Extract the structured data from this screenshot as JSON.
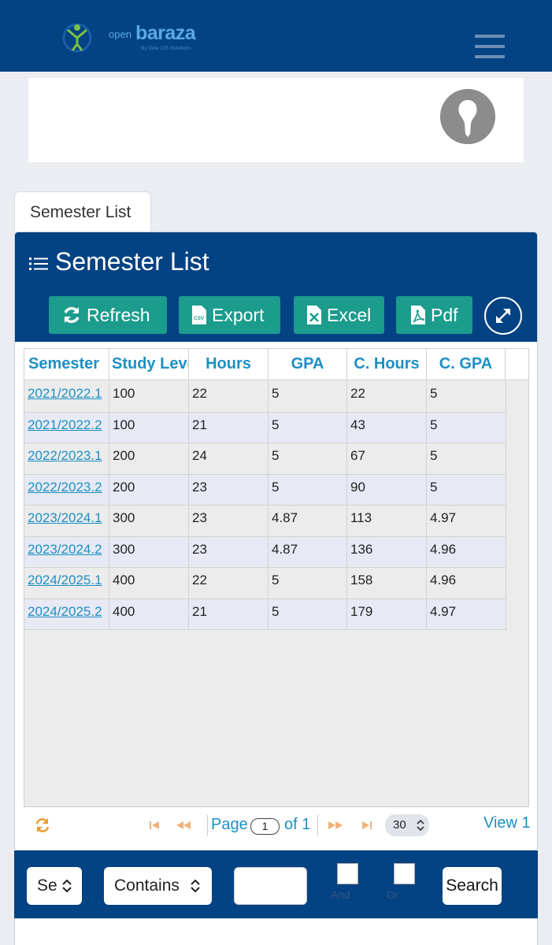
{
  "header": {
    "logo_open": "open",
    "logo_baraza": "baraza",
    "logo_sub": "By Dew CIS Solutions",
    "brand_color": "#034283",
    "menu_icon": "hamburger-menu-icon"
  },
  "profile": {
    "avatar_icon": "user-avatar-icon"
  },
  "tab": {
    "label": "Semester List"
  },
  "panel": {
    "title": "Semester List",
    "title_icon": "list-icon",
    "buttons": [
      {
        "label": "Refresh",
        "icon": "refresh-icon"
      },
      {
        "label": "Export",
        "icon": "csv-file-icon"
      },
      {
        "label": "Excel",
        "icon": "excel-file-icon"
      },
      {
        "label": "Pdf",
        "icon": "pdf-file-icon"
      }
    ],
    "expand_icon": "expand-icon",
    "accent_color": "#1b9c8d"
  },
  "table": {
    "columns": [
      "Semester",
      "Study Level",
      "Hours",
      "GPA",
      "C. Hours",
      "C. GPA"
    ],
    "rows": [
      [
        "2021/2022.1",
        "100",
        "22",
        "5",
        "22",
        "5"
      ],
      [
        "2021/2022.2",
        "100",
        "21",
        "5",
        "43",
        "5"
      ],
      [
        "2022/2023.1",
        "200",
        "24",
        "5",
        "67",
        "5"
      ],
      [
        "2022/2023.2",
        "200",
        "23",
        "5",
        "90",
        "5"
      ],
      [
        "2023/2024.1",
        "300",
        "23",
        "4.87",
        "113",
        "4.97"
      ],
      [
        "2023/2024.2",
        "300",
        "23",
        "4.87",
        "136",
        "4.96"
      ],
      [
        "2024/2025.1",
        "400",
        "22",
        "5",
        "158",
        "4.96"
      ],
      [
        "2024/2025.2",
        "400",
        "21",
        "5",
        "179",
        "4.97"
      ]
    ]
  },
  "pager": {
    "page_label": "Page",
    "page_value": "1",
    "of_label": "of 1",
    "rows_per_page": "30",
    "view_text": "View 1"
  },
  "filter": {
    "field_select": "Se",
    "operator_select": "Contains",
    "input_value": "",
    "and_label": "And",
    "or_label": "Or",
    "search_label": "Search"
  }
}
